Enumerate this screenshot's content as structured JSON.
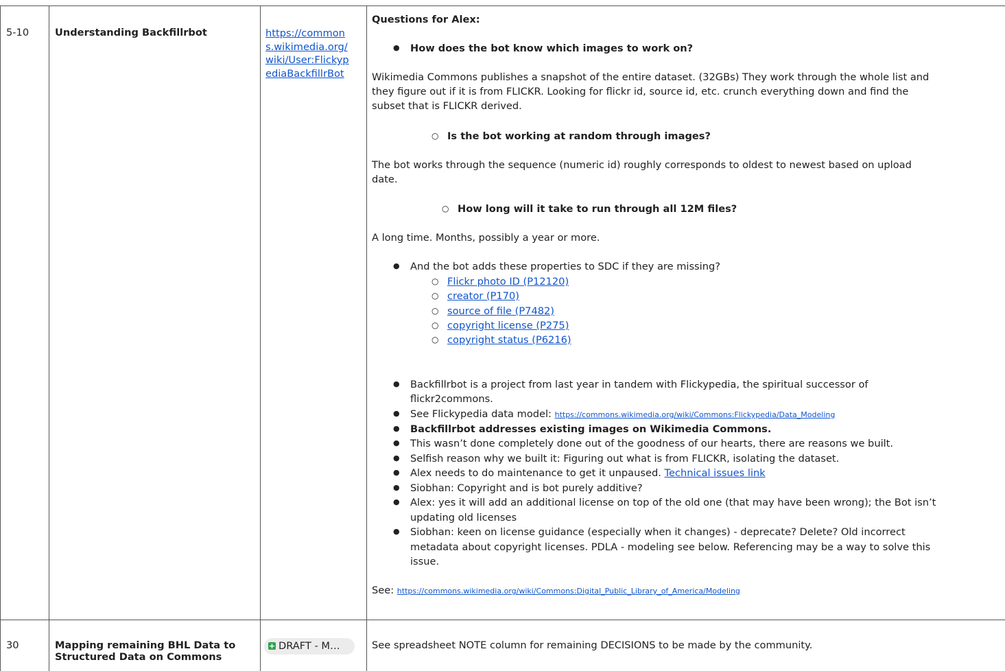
{
  "rows": [
    {
      "duration": "5-10",
      "topic": "Understanding Backfillrbot",
      "link_lines": [
        "https://common",
        "s.wikimedia.org/",
        "wiki/User:Flickyp",
        "ediaBackfillrBot"
      ],
      "notes": {
        "heading": "Questions for Alex:",
        "q1": "How does the bot know which images to work on?",
        "a1": [
          "Wikimedia Commons publishes a snapshot of the entire dataset. (32GBs) They work through the whole list and",
          "they figure out if it is from FLICKR. Looking for flickr id, source id, etc. crunch everything down and find the",
          "subset that is FLICKR derived."
        ],
        "q2": "Is the bot working at random through images?",
        "a2": [
          " The bot works through the sequence (numeric id) roughly corresponds to oldest to newest based on upload",
          "date."
        ],
        "q3": "How long will it take to run through all 12M files?",
        "a3": "A long time. Months, possibly a year or more.",
        "props_intro": "And the bot adds these properties to SDC if they are missing?",
        "props": [
          "Flickr photo ID (P12120)",
          "creator (P170)",
          "source of file (P7482)",
          "copyright license (P275)",
          "copyright status (P6216)"
        ],
        "b1": [
          "Backfillrbot is a project from last year in tandem with Flickypedia, the spiritual successor of",
          "flickr2commons."
        ],
        "b2_text": "See Flickypedia data model: ",
        "b2_link": "https://commons.wikimedia.org/wiki/Commons:Flickypedia/Data_Modeling",
        "b3": "Backfillrbot addresses existing images on Wikimedia Commons.",
        "b4": "This wasn’t done completely done out of the goodness of our hearts, there are reasons we built.",
        "b5": "Selfish reason why we built it: Figuring out what is from FLICKR, isolating the dataset.",
        "b6_text": "Alex needs to do maintenance to get it unpaused. ",
        "b6_link": "Technical issues link",
        "b7": "Siobhan: Copyright and is bot purely additive?",
        "b8": [
          "Alex: yes it will add an additional license on top of the old one (that may have been wrong); the Bot isn’t",
          "updating old licenses"
        ],
        "b9": [
          "Siobhan: keen on license guidance (especially when it changes) - deprecate? Delete? Old incorrect",
          "metadata about copyright licenses. PDLA - modeling see below. Referencing may be a way to solve this",
          "issue."
        ],
        "see_text": "See: ",
        "see_link": "https://commons.wikimedia.org/wiki/Commons:Digital_Public_Library_of_America/Modeling"
      }
    },
    {
      "duration": "30",
      "topic_lines": [
        "Mapping remaining BHL Data to",
        "Structured Data on Commons"
      ],
      "chip": "DRAFT - M…",
      "notes": "See spreadsheet NOTE column for remaining DECISIONS to be made by the community."
    }
  ]
}
